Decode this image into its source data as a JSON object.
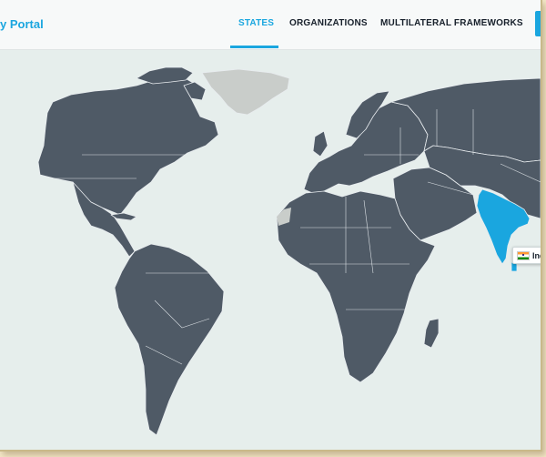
{
  "header": {
    "brand": "y Portal",
    "nav": [
      {
        "label": "STATES",
        "active": true
      },
      {
        "label": "ORGANIZATIONS",
        "active": false
      },
      {
        "label": "MULTILATERAL FRAMEWORKS",
        "active": false
      }
    ]
  },
  "map": {
    "highlighted_country": "India",
    "tooltip": {
      "label": "India",
      "icon": "india-flag-icon"
    },
    "colors": {
      "ocean": "#e6eeec",
      "land": "#4f5a66",
      "unlisted_land": "#c9cdca",
      "highlight": "#1aa6df",
      "borders": "#e8ecef"
    }
  },
  "colors": {
    "accent": "#1aa6df",
    "nav_text": "#17202b",
    "page_margin": "#f3e6c6"
  }
}
